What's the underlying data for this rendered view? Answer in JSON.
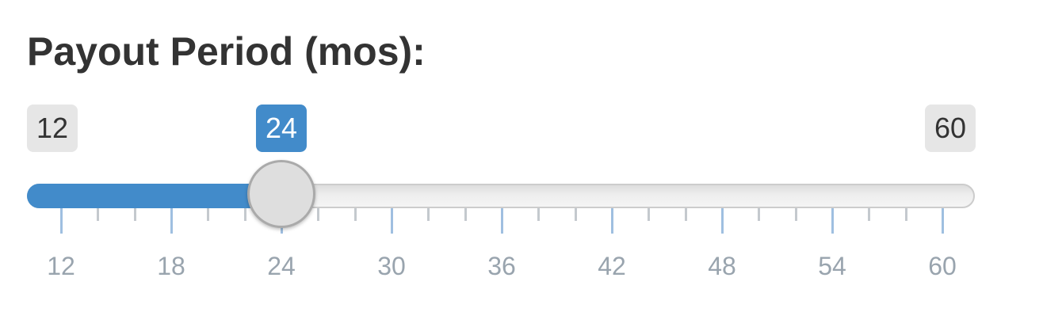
{
  "label": "Payout Period (mos):",
  "slider": {
    "min": 12,
    "max": 60,
    "value": 24,
    "step": 6,
    "minor_ticks_between": 2,
    "min_label": "12",
    "max_label": "60",
    "value_label": "24",
    "tick_labels": [
      "12",
      "18",
      "24",
      "30",
      "36",
      "42",
      "48",
      "54",
      "60"
    ]
  },
  "colors": {
    "accent": "#428bca",
    "text": "#333333",
    "tick_label": "#99a4ae",
    "badge_bg": "#e6e6e6"
  }
}
